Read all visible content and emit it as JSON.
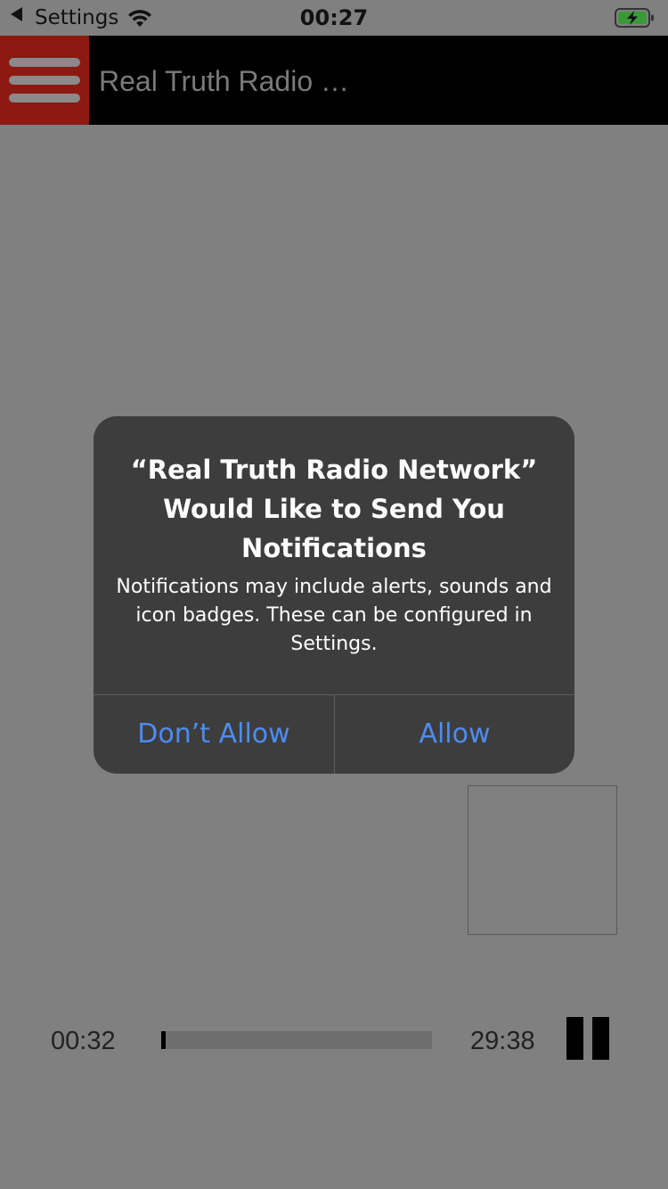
{
  "status_bar": {
    "back_label": "Settings",
    "time": "00:27",
    "icons": [
      "back-arrow-icon",
      "wifi-icon",
      "battery-charging-icon"
    ]
  },
  "header": {
    "title": "Real Truth Radio …",
    "menu_icon": "hamburger-menu-icon",
    "colors": {
      "background": "#000000",
      "menu_button": "#8c1a12"
    }
  },
  "dialog": {
    "title": "“Real Truth Radio Network” Would Like to Send You Notifications",
    "message": "Notifications may include alerts, sounds and icon badges. These can be configured in Settings.",
    "buttons": {
      "deny": "Don’t Allow",
      "allow": "Allow"
    },
    "colors": {
      "background": "#3d3d3d",
      "button_text": "#4d8cf0"
    }
  },
  "player": {
    "elapsed": "00:32",
    "total": "29:38",
    "progress": 0.018,
    "pause_icon": "pause-icon"
  }
}
